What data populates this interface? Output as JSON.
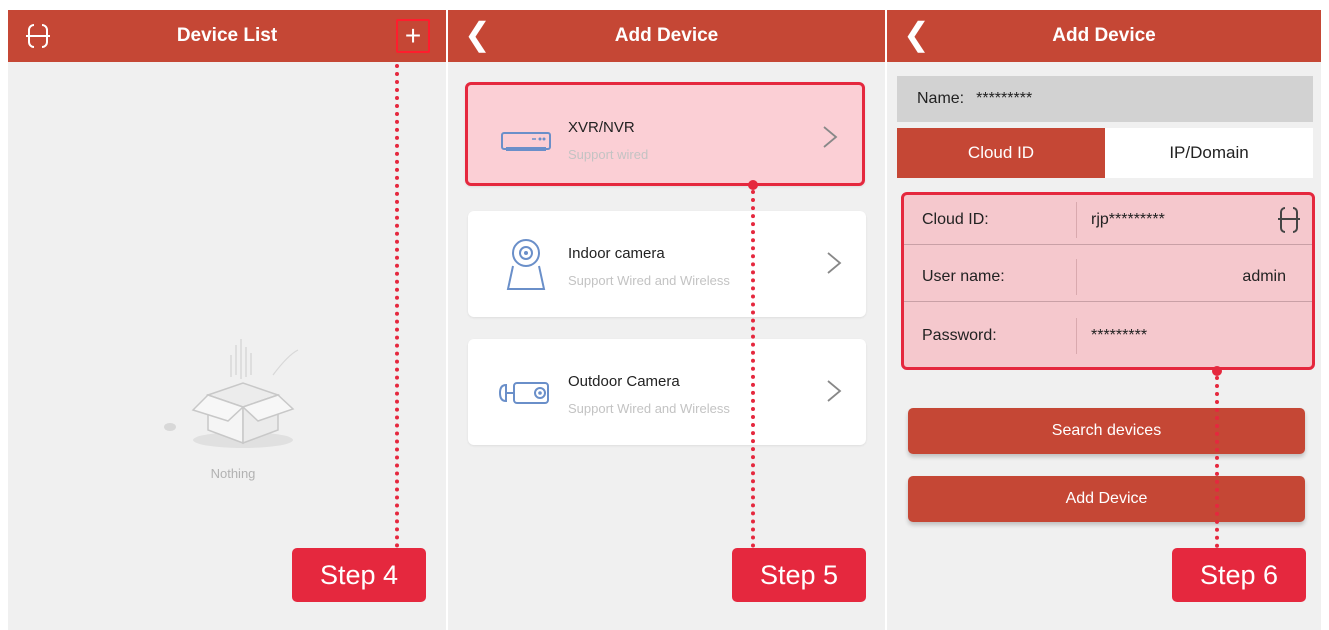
{
  "device_list": {
    "title": "Device List",
    "add_icon": "plus-icon",
    "menu_icon": "scan-icon",
    "empty_text": "Nothing"
  },
  "add_device_types": {
    "title": "Add Device",
    "items": [
      {
        "name": "XVR/NVR",
        "sub": "Support wired",
        "icon": "xvr-recorder-icon"
      },
      {
        "name": "Indoor camera",
        "sub": "Support Wired and Wireless",
        "icon": "indoor-camera-icon"
      },
      {
        "name": "Outdoor Camera",
        "sub": "Support Wired and Wireless",
        "icon": "outdoor-camera-icon"
      }
    ]
  },
  "add_device_form": {
    "title": "Add Device",
    "name_label": "Name:",
    "name_value": "*********",
    "tabs": [
      "Cloud ID",
      "IP/Domain"
    ],
    "fields": [
      {
        "label": "Cloud ID:",
        "value": "rjp*********"
      },
      {
        "label": "User name:",
        "value": "admin"
      },
      {
        "label": "Password:",
        "value": "*********"
      }
    ],
    "search_button": "Search devices",
    "add_button": "Add Device"
  },
  "steps": [
    "Step 4",
    "Step 5",
    "Step 6"
  ],
  "colors": {
    "header": "#c54735",
    "highlight": "#e5283e",
    "highlight_fill": "#fbcfd5"
  }
}
